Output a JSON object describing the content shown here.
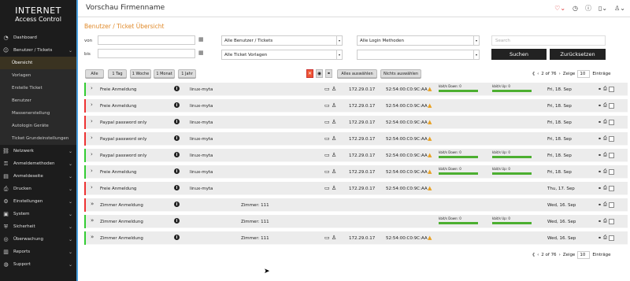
{
  "brand": {
    "line1": "INTERNET",
    "line2": "Access Control"
  },
  "sidebar": {
    "items": [
      {
        "label": "Dashboard",
        "icon": "gauge-icon"
      },
      {
        "label": "Benutzer / Tickets",
        "icon": "user-icon",
        "expanded": true
      }
    ],
    "subitems": [
      {
        "label": "Übersicht",
        "active": true
      },
      {
        "label": "Vorlagen"
      },
      {
        "label": "Erstelle Ticket"
      },
      {
        "label": "Benutzer"
      },
      {
        "label": "Massenerstellung"
      },
      {
        "label": "Autologin Geräte"
      },
      {
        "label": "Ticket Grundeinstellungen"
      }
    ],
    "more": [
      {
        "label": "Netzwerk",
        "icon": "network-icon"
      },
      {
        "label": "Anmeldemethoden",
        "icon": "key-icon"
      },
      {
        "label": "Anmeldeseite",
        "icon": "page-icon"
      },
      {
        "label": "Drucken",
        "icon": "printer-icon"
      },
      {
        "label": "Einstellungen",
        "icon": "gear-icon"
      },
      {
        "label": "System",
        "icon": "system-icon"
      },
      {
        "label": "Sicherheit",
        "icon": "shield-icon"
      },
      {
        "label": "Überwachung",
        "icon": "monitor-icon"
      },
      {
        "label": "Reports",
        "icon": "chart-icon"
      },
      {
        "label": "Support",
        "icon": "lifebuoy-icon"
      }
    ]
  },
  "header": {
    "title": "Vorschau Firmenname"
  },
  "page": {
    "title": "Benutzer / Ticket Übersicht"
  },
  "filters": {
    "from_label": "von",
    "to_label": "bis",
    "user_select": "Alle Benutzer / Tickets",
    "template_select": "Alle Ticket Vorlagen",
    "login_select": "Alle Login Methoden",
    "search_placeholder": "Search",
    "search_button": "Suchen",
    "reset_button": "Zurücksetzen"
  },
  "quick": [
    "Alle",
    "1 Tag",
    "1 Woche",
    "1 Monat",
    "1 Jahr"
  ],
  "select_all": "Alles auswählen",
  "select_none": "Nichts auswählen",
  "pager": {
    "info": "2 of 76",
    "show": "Zeige",
    "per_page": "10",
    "entries": "Einträge"
  },
  "rows": [
    {
      "name": "Freie Anmeldung",
      "user": "linux-myta",
      "room": "",
      "ip": "172.29.0.17",
      "mac": "52:54:00:C0:9C:AA",
      "dl": "kbit/s Down: 0",
      "ul": "kbit/s Up: 0",
      "date": "Fri, 18. Sep",
      "color": "#3c3",
      "device": true,
      "traffic": true,
      "double": false
    },
    {
      "name": "Freie Anmeldung",
      "user": "linux-myta",
      "room": "",
      "ip": "172.29.0.17",
      "mac": "52:54:00:C0:9C:AA",
      "dl": "",
      "ul": "",
      "date": "Fri, 18. Sep",
      "color": "#e33",
      "device": true,
      "traffic": false,
      "double": false
    },
    {
      "name": "Paypal password only",
      "user": "linux-myta",
      "room": "",
      "ip": "172.29.0.17",
      "mac": "52:54:00:C0:9C:AA",
      "dl": "",
      "ul": "",
      "date": "Fri, 18. Sep",
      "color": "#e33",
      "device": true,
      "traffic": false,
      "double": false
    },
    {
      "name": "Paypal password only",
      "user": "linux-myta",
      "room": "",
      "ip": "172.29.0.17",
      "mac": "52:54:00:C0:9C:AA",
      "dl": "",
      "ul": "",
      "date": "Fri, 18. Sep",
      "color": "#e33",
      "device": true,
      "traffic": false,
      "double": false
    },
    {
      "name": "Paypal password only",
      "user": "linux-myta",
      "room": "",
      "ip": "172.29.0.17",
      "mac": "52:54:00:C0:9C:AA",
      "dl": "kbit/s Down: 0",
      "ul": "kbit/s Up: 0",
      "date": "Fri, 18. Sep",
      "color": "#3c3",
      "device": true,
      "traffic": true,
      "double": false
    },
    {
      "name": "Freie Anmeldung",
      "user": "linux-myta",
      "room": "",
      "ip": "172.29.0.17",
      "mac": "52:54:00:C0:9C:AA",
      "dl": "kbit/s Down: 0",
      "ul": "kbit/s Up: 0",
      "date": "Fri, 18. Sep",
      "color": "#3c3",
      "device": true,
      "traffic": true,
      "double": false
    },
    {
      "name": "Freie Anmeldung",
      "user": "linux-myta",
      "room": "",
      "ip": "172.29.0.17",
      "mac": "52:54:00:C0:9C:AA",
      "dl": "",
      "ul": "",
      "date": "Thu, 17. Sep",
      "color": "#e33",
      "device": true,
      "traffic": false,
      "double": false
    },
    {
      "name": "Zimmer Anmeldung",
      "user": "",
      "room": "Zimmer: 111",
      "ip": "",
      "mac": "",
      "dl": "",
      "ul": "",
      "date": "Wed, 16. Sep",
      "color": "#e33",
      "device": false,
      "traffic": false,
      "double": true
    },
    {
      "name": "Zimmer Anmeldung",
      "user": "",
      "room": "Zimmer: 111",
      "ip": "",
      "mac": "",
      "dl": "kbit/s Down: 0",
      "ul": "kbit/s Up: 0",
      "date": "Wed, 16. Sep",
      "color": "#3c3",
      "device": false,
      "traffic": true,
      "double": true
    },
    {
      "name": "Zimmer Anmeldung",
      "user": "",
      "room": "Zimmer: 111",
      "ip": "172.29.0.17",
      "mac": "52:54:00:C0:9C:AA",
      "dl": "",
      "ul": "",
      "date": "Wed, 16. Sep",
      "color": "#3c3",
      "device": true,
      "traffic": false,
      "double": true
    }
  ]
}
